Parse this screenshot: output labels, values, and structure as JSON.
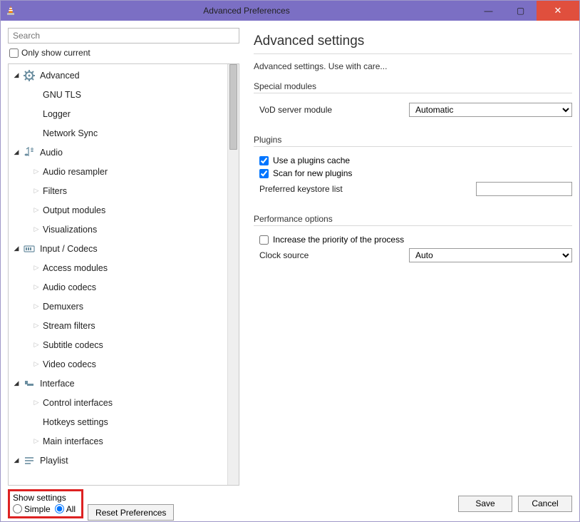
{
  "window": {
    "title": "Advanced Preferences"
  },
  "search": {
    "placeholder": "Search"
  },
  "only_show_current": "Only show current",
  "tree": {
    "advanced": {
      "label": "Advanced",
      "items": [
        "GNU TLS",
        "Logger",
        "Network Sync"
      ]
    },
    "audio": {
      "label": "Audio",
      "items": [
        "Audio resampler",
        "Filters",
        "Output modules",
        "Visualizations"
      ]
    },
    "input_codecs": {
      "label": "Input / Codecs",
      "items": [
        "Access modules",
        "Audio codecs",
        "Demuxers",
        "Stream filters",
        "Subtitle codecs",
        "Video codecs"
      ]
    },
    "interface": {
      "label": "Interface",
      "items": [
        "Control interfaces",
        "Hotkeys settings",
        "Main interfaces"
      ]
    },
    "playlist": {
      "label": "Playlist"
    }
  },
  "right": {
    "heading": "Advanced settings",
    "subtext": "Advanced settings. Use with care...",
    "groups": {
      "special": {
        "label": "Special modules",
        "vod_label": "VoD server module",
        "vod_value": "Automatic"
      },
      "plugins": {
        "label": "Plugins",
        "use_cache": "Use a plugins cache",
        "scan_new": "Scan for new plugins",
        "keystore_label": "Preferred keystore list",
        "keystore_value": ""
      },
      "performance": {
        "label": "Performance options",
        "increase": "Increase the priority of the process",
        "clock_label": "Clock source",
        "clock_value": "Auto"
      }
    }
  },
  "footer": {
    "show_settings": "Show settings",
    "simple": "Simple",
    "all": "All",
    "reset": "Reset Preferences",
    "save": "Save",
    "cancel": "Cancel"
  }
}
